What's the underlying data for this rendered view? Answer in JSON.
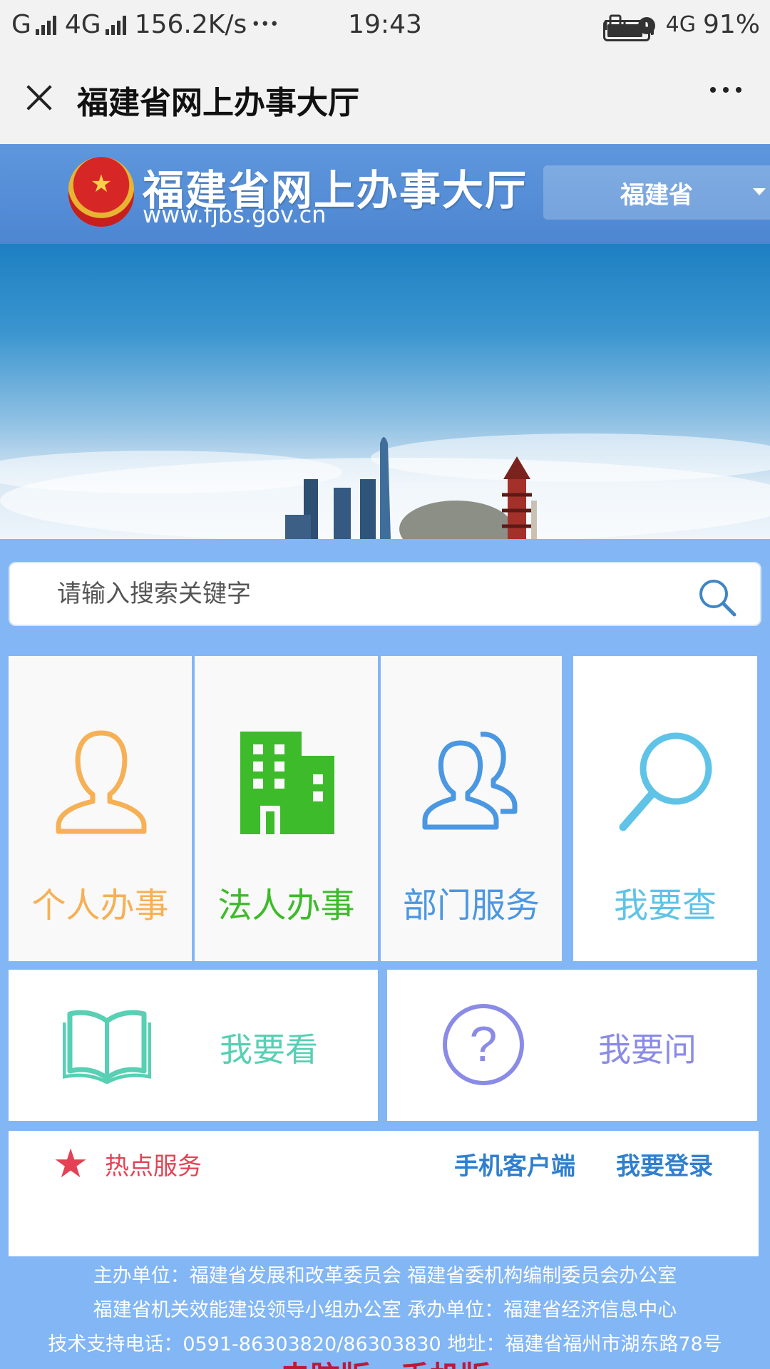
{
  "status_bar": {
    "carrier1": "G",
    "carrier2": "4G",
    "speed": "156.2K/s",
    "dots": "•••",
    "time": "19:43",
    "network": "4G",
    "battery_text": "91%",
    "battery_level": 0.91
  },
  "title_bar": {
    "title": "福建省网上办事大厅"
  },
  "site_header": {
    "name": "福建省网上办事大厅",
    "url": "www.fjbs.gov.cn",
    "region": "福建省"
  },
  "search": {
    "placeholder": "请输入搜索关键字"
  },
  "services": {
    "personal": "个人办事",
    "legal": "法人办事",
    "department": "部门服务",
    "query": "我要查",
    "view": "我要看",
    "ask": "我要问"
  },
  "hot": {
    "label": "热点服务",
    "mobile_client": "手机客户端",
    "login": "我要登录"
  },
  "footer": {
    "line1": "主办单位：福建省发展和改革委员会 福建省委机构编制委员会办公室",
    "line2": "福建省机关效能建设领导小组办公室 承办单位：福建省经济信息中心",
    "line3": "技术支持电话：0591-86303820/86303830 地址：福建省福州市湖东路78号",
    "switch": "电脑版　手机版"
  },
  "colors": {
    "header_blue": "#4d86d1",
    "main_blue": "#82b6f4",
    "personal": "#f6b055",
    "legal": "#3dbb2a",
    "department": "#4a97e2",
    "query": "#5fc3e8",
    "view": "#57d0b4",
    "ask": "#8a8be6",
    "hot_red": "#e44254",
    "link_blue": "#2f7fcf"
  }
}
